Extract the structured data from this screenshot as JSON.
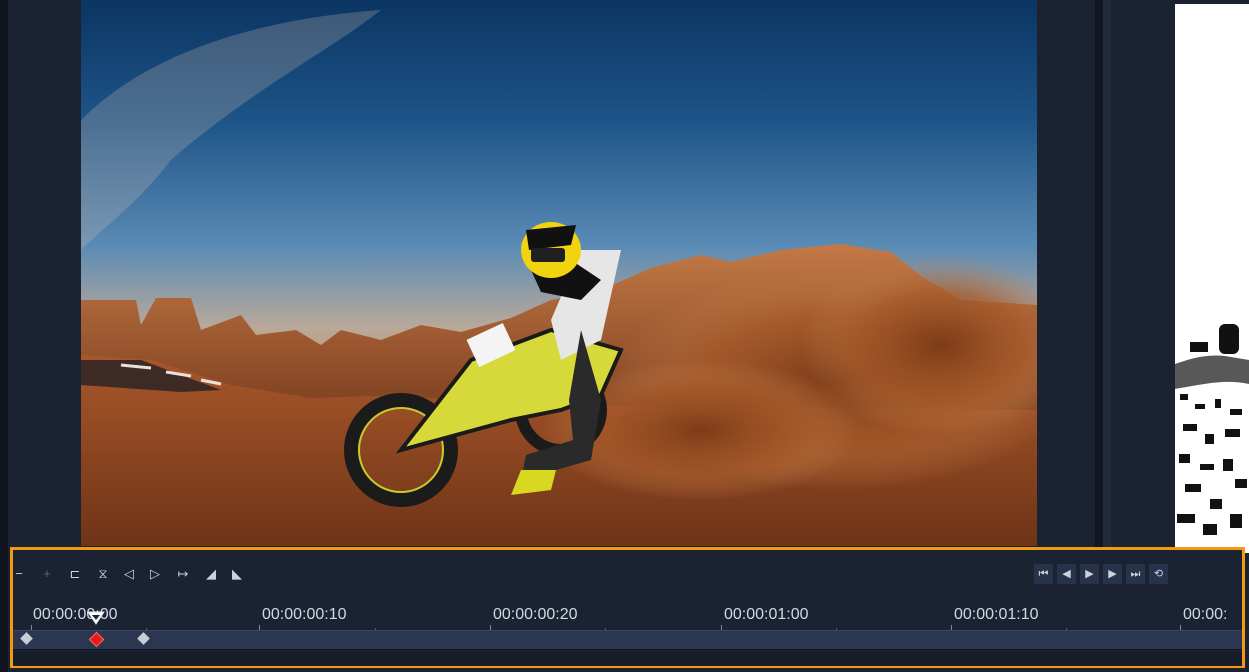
{
  "preview": {
    "subject": "motocross-rider",
    "colors": {
      "sky_top": "#0b3563",
      "sand": "#b86a2c",
      "helmet": "#f2d30f"
    }
  },
  "toolbar": {
    "edit_tools": [
      {
        "icon": "minus-icon",
        "glyph": "−"
      },
      {
        "icon": "add-keyframe-icon",
        "glyph": "+"
      },
      {
        "icon": "remove-keyframe-icon",
        "glyph": "⊏"
      },
      {
        "icon": "reverse-keyframes-icon",
        "glyph": "⧖"
      },
      {
        "icon": "previous-keyframe-icon",
        "glyph": "◁"
      },
      {
        "icon": "next-keyframe-icon",
        "glyph": "▷"
      },
      {
        "icon": "copy-keyframe-icon",
        "glyph": "↦"
      },
      {
        "icon": "fade-in-icon",
        "glyph": "◢"
      },
      {
        "icon": "fade-out-icon",
        "glyph": "◣"
      }
    ],
    "playback": [
      {
        "icon": "go-to-start-icon",
        "glyph": "⏮"
      },
      {
        "icon": "step-back-icon",
        "glyph": "◀"
      },
      {
        "icon": "play-icon",
        "glyph": "▶"
      },
      {
        "icon": "step-forward-icon",
        "glyph": "▶"
      },
      {
        "icon": "go-to-end-icon",
        "glyph": "⏭"
      },
      {
        "icon": "repeat-icon",
        "glyph": "⟲"
      }
    ]
  },
  "timeline": {
    "labels": [
      "00:00:00:00",
      "00:00:00:10",
      "00:00:00:20",
      "00:00:01:00",
      "00:00:01:10",
      "00:00:"
    ],
    "accent_color": "#f39a12",
    "keyframe_count": 3,
    "current_keyframe_index": 1
  }
}
